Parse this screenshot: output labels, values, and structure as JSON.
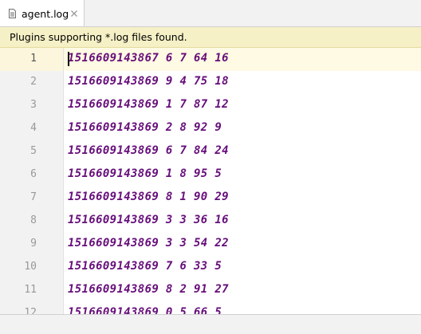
{
  "tab": {
    "title": "agent.log",
    "file_icon": "text-file-icon",
    "close_icon": "close-icon"
  },
  "banner": {
    "text": "Plugins supporting *.log files found."
  },
  "editor": {
    "lines": [
      {
        "number": "1",
        "text": "1516609143867 6 7 64 16"
      },
      {
        "number": "2",
        "text": "1516609143869 9 4 75 18"
      },
      {
        "number": "3",
        "text": "1516609143869 1 7 87 12"
      },
      {
        "number": "4",
        "text": "1516609143869 2 8 92 9"
      },
      {
        "number": "5",
        "text": "1516609143869 6 7 84 24"
      },
      {
        "number": "6",
        "text": "1516609143869 1 8 95 5"
      },
      {
        "number": "7",
        "text": "1516609143869 8 1 90 29"
      },
      {
        "number": "8",
        "text": "1516609143869 3 3 36 16"
      },
      {
        "number": "9",
        "text": "1516609143869 3 3 54 22"
      },
      {
        "number": "10",
        "text": "1516609143869 7 6 33 5"
      },
      {
        "number": "11",
        "text": "1516609143869 8 2 91 27"
      },
      {
        "number": "12",
        "text": "1516609143869 0 5 66 5"
      }
    ]
  },
  "colors": {
    "code_text": "#660e7a",
    "banner_bg": "#f5f0c5",
    "current_line_bg": "#fffae3",
    "gutter_bg": "#f2f2f2"
  }
}
